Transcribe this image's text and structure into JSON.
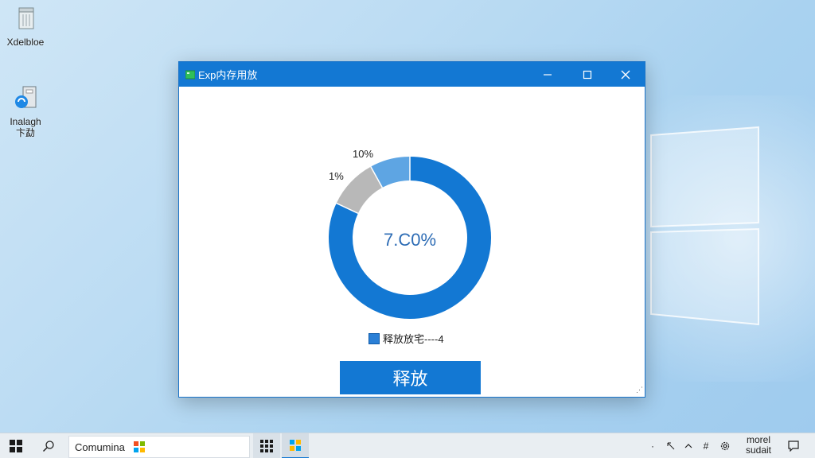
{
  "desktop": {
    "icons": [
      {
        "label": "Xdelbloe"
      },
      {
        "label": "Inalagh\n卞勐"
      }
    ]
  },
  "window": {
    "title": "Exp内存用放",
    "controls": {
      "minimize": "—",
      "maximize": "☐",
      "close": "✕"
    },
    "donut": {
      "center_label": "7.C0%",
      "segment_labels": [
        "10%",
        "1%"
      ]
    },
    "legend_label": "释放放宅----4",
    "button_label": "释放"
  },
  "chart_data": {
    "type": "pie",
    "slices": [
      {
        "label": "10%",
        "value": 10,
        "color": "#b8b8b8"
      },
      {
        "label": "1%",
        "value": 8,
        "color": "#5ea5e3"
      },
      {
        "label": "",
        "value": 82,
        "color": "#1378d3"
      }
    ],
    "center_text": "7.C0%"
  },
  "taskbar": {
    "search_text": "Comumina",
    "clock_lines": [
      "morel",
      "sudait"
    ]
  },
  "colors": {
    "accent": "#1378d3",
    "titlebar": "#1378d3",
    "donut_main": "#1378d3",
    "donut_light": "#5ea5e3",
    "donut_gray": "#b8b8b8"
  }
}
